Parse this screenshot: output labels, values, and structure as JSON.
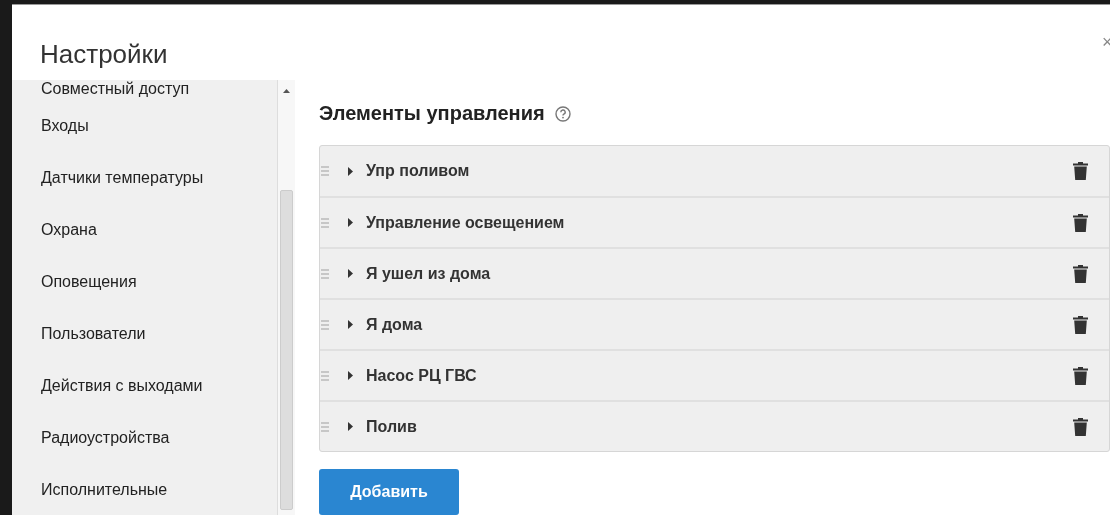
{
  "window": {
    "title": "Настройки",
    "close": "×"
  },
  "sidebar": {
    "items": [
      {
        "label": "Совместный доступ",
        "selected": false
      },
      {
        "label": "Входы",
        "selected": false
      },
      {
        "label": "Датчики температуры",
        "selected": false
      },
      {
        "label": "Охрана",
        "selected": false
      },
      {
        "label": "Оповещения",
        "selected": false
      },
      {
        "label": "Пользователи",
        "selected": false
      },
      {
        "label": "Действия с выходами",
        "selected": false
      },
      {
        "label": "Радиоустройства",
        "selected": false
      },
      {
        "label": "Исполнительные",
        "selected": false
      }
    ]
  },
  "content": {
    "heading": "Элементы управления",
    "controls": [
      {
        "name": "Упр поливом",
        "expanded": false
      },
      {
        "name": "Управление освещением",
        "expanded": false
      },
      {
        "name": "Я ушел из дома",
        "expanded": false
      },
      {
        "name": "Я дома",
        "expanded": false
      },
      {
        "name": "Насос РЦ ГВС",
        "expanded": false
      },
      {
        "name": "Полив",
        "expanded": false
      }
    ],
    "add_button": "Добавить"
  }
}
